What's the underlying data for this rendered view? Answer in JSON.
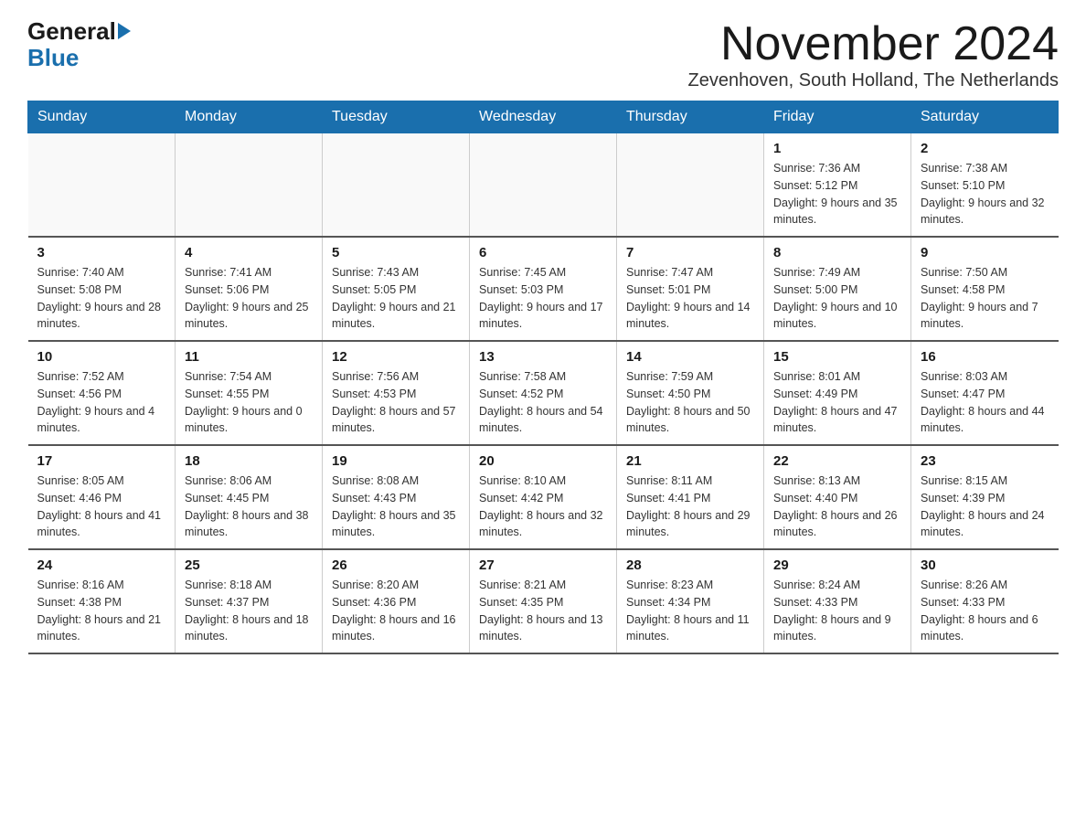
{
  "logo": {
    "general": "General",
    "blue": "Blue"
  },
  "header": {
    "month_year": "November 2024",
    "location": "Zevenhoven, South Holland, The Netherlands"
  },
  "days_of_week": [
    "Sunday",
    "Monday",
    "Tuesday",
    "Wednesday",
    "Thursday",
    "Friday",
    "Saturday"
  ],
  "weeks": [
    [
      {
        "day": "",
        "info": ""
      },
      {
        "day": "",
        "info": ""
      },
      {
        "day": "",
        "info": ""
      },
      {
        "day": "",
        "info": ""
      },
      {
        "day": "",
        "info": ""
      },
      {
        "day": "1",
        "info": "Sunrise: 7:36 AM\nSunset: 5:12 PM\nDaylight: 9 hours and 35 minutes."
      },
      {
        "day": "2",
        "info": "Sunrise: 7:38 AM\nSunset: 5:10 PM\nDaylight: 9 hours and 32 minutes."
      }
    ],
    [
      {
        "day": "3",
        "info": "Sunrise: 7:40 AM\nSunset: 5:08 PM\nDaylight: 9 hours and 28 minutes."
      },
      {
        "day": "4",
        "info": "Sunrise: 7:41 AM\nSunset: 5:06 PM\nDaylight: 9 hours and 25 minutes."
      },
      {
        "day": "5",
        "info": "Sunrise: 7:43 AM\nSunset: 5:05 PM\nDaylight: 9 hours and 21 minutes."
      },
      {
        "day": "6",
        "info": "Sunrise: 7:45 AM\nSunset: 5:03 PM\nDaylight: 9 hours and 17 minutes."
      },
      {
        "day": "7",
        "info": "Sunrise: 7:47 AM\nSunset: 5:01 PM\nDaylight: 9 hours and 14 minutes."
      },
      {
        "day": "8",
        "info": "Sunrise: 7:49 AM\nSunset: 5:00 PM\nDaylight: 9 hours and 10 minutes."
      },
      {
        "day": "9",
        "info": "Sunrise: 7:50 AM\nSunset: 4:58 PM\nDaylight: 9 hours and 7 minutes."
      }
    ],
    [
      {
        "day": "10",
        "info": "Sunrise: 7:52 AM\nSunset: 4:56 PM\nDaylight: 9 hours and 4 minutes."
      },
      {
        "day": "11",
        "info": "Sunrise: 7:54 AM\nSunset: 4:55 PM\nDaylight: 9 hours and 0 minutes."
      },
      {
        "day": "12",
        "info": "Sunrise: 7:56 AM\nSunset: 4:53 PM\nDaylight: 8 hours and 57 minutes."
      },
      {
        "day": "13",
        "info": "Sunrise: 7:58 AM\nSunset: 4:52 PM\nDaylight: 8 hours and 54 minutes."
      },
      {
        "day": "14",
        "info": "Sunrise: 7:59 AM\nSunset: 4:50 PM\nDaylight: 8 hours and 50 minutes."
      },
      {
        "day": "15",
        "info": "Sunrise: 8:01 AM\nSunset: 4:49 PM\nDaylight: 8 hours and 47 minutes."
      },
      {
        "day": "16",
        "info": "Sunrise: 8:03 AM\nSunset: 4:47 PM\nDaylight: 8 hours and 44 minutes."
      }
    ],
    [
      {
        "day": "17",
        "info": "Sunrise: 8:05 AM\nSunset: 4:46 PM\nDaylight: 8 hours and 41 minutes."
      },
      {
        "day": "18",
        "info": "Sunrise: 8:06 AM\nSunset: 4:45 PM\nDaylight: 8 hours and 38 minutes."
      },
      {
        "day": "19",
        "info": "Sunrise: 8:08 AM\nSunset: 4:43 PM\nDaylight: 8 hours and 35 minutes."
      },
      {
        "day": "20",
        "info": "Sunrise: 8:10 AM\nSunset: 4:42 PM\nDaylight: 8 hours and 32 minutes."
      },
      {
        "day": "21",
        "info": "Sunrise: 8:11 AM\nSunset: 4:41 PM\nDaylight: 8 hours and 29 minutes."
      },
      {
        "day": "22",
        "info": "Sunrise: 8:13 AM\nSunset: 4:40 PM\nDaylight: 8 hours and 26 minutes."
      },
      {
        "day": "23",
        "info": "Sunrise: 8:15 AM\nSunset: 4:39 PM\nDaylight: 8 hours and 24 minutes."
      }
    ],
    [
      {
        "day": "24",
        "info": "Sunrise: 8:16 AM\nSunset: 4:38 PM\nDaylight: 8 hours and 21 minutes."
      },
      {
        "day": "25",
        "info": "Sunrise: 8:18 AM\nSunset: 4:37 PM\nDaylight: 8 hours and 18 minutes."
      },
      {
        "day": "26",
        "info": "Sunrise: 8:20 AM\nSunset: 4:36 PM\nDaylight: 8 hours and 16 minutes."
      },
      {
        "day": "27",
        "info": "Sunrise: 8:21 AM\nSunset: 4:35 PM\nDaylight: 8 hours and 13 minutes."
      },
      {
        "day": "28",
        "info": "Sunrise: 8:23 AM\nSunset: 4:34 PM\nDaylight: 8 hours and 11 minutes."
      },
      {
        "day": "29",
        "info": "Sunrise: 8:24 AM\nSunset: 4:33 PM\nDaylight: 8 hours and 9 minutes."
      },
      {
        "day": "30",
        "info": "Sunrise: 8:26 AM\nSunset: 4:33 PM\nDaylight: 8 hours and 6 minutes."
      }
    ]
  ]
}
